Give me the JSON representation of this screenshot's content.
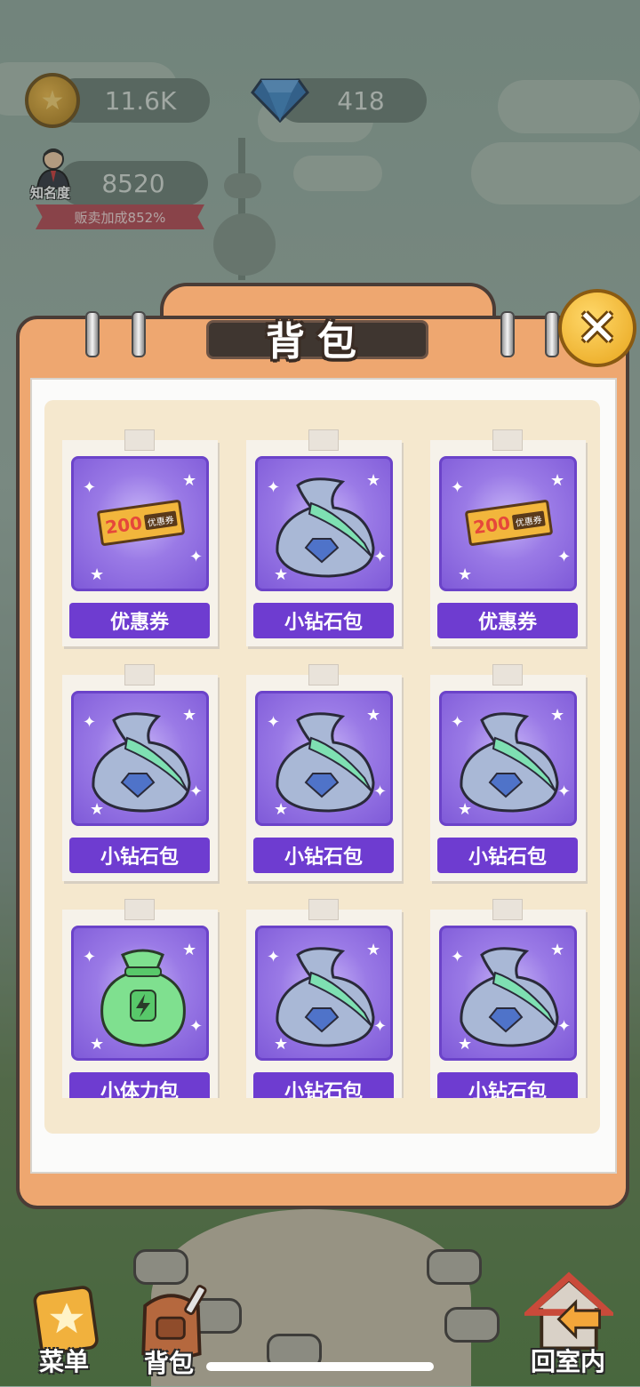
{
  "hud": {
    "coins": "11.6K",
    "gems": "418",
    "fame_label": "知名度",
    "fame": "8520",
    "sell_bonus": "贩卖加成852%"
  },
  "dialog": {
    "title": "背包",
    "close_icon": "close-icon"
  },
  "items": [
    {
      "name": "优惠券",
      "icon": "coupon-icon",
      "coupon_value": "200",
      "coupon_text": "优惠券"
    },
    {
      "name": "小钻石包",
      "icon": "diamond-bag-icon"
    },
    {
      "name": "优惠券",
      "icon": "coupon-icon",
      "coupon_value": "200",
      "coupon_text": "优惠券"
    },
    {
      "name": "小钻石包",
      "icon": "diamond-bag-icon"
    },
    {
      "name": "小钻石包",
      "icon": "diamond-bag-icon"
    },
    {
      "name": "小钻石包",
      "icon": "diamond-bag-icon"
    },
    {
      "name": "小体力包",
      "icon": "energy-bag-icon"
    },
    {
      "name": "小钻石包",
      "icon": "diamond-bag-icon"
    },
    {
      "name": "小钻石包",
      "icon": "diamond-bag-icon"
    }
  ],
  "nav": {
    "menu": "菜单",
    "backpack": "背包",
    "go_home": "回室内"
  },
  "colors": {
    "dialog_orange": "#eea770",
    "tile_purple": "#7f5ad8",
    "label_purple": "#6e3cd0"
  }
}
